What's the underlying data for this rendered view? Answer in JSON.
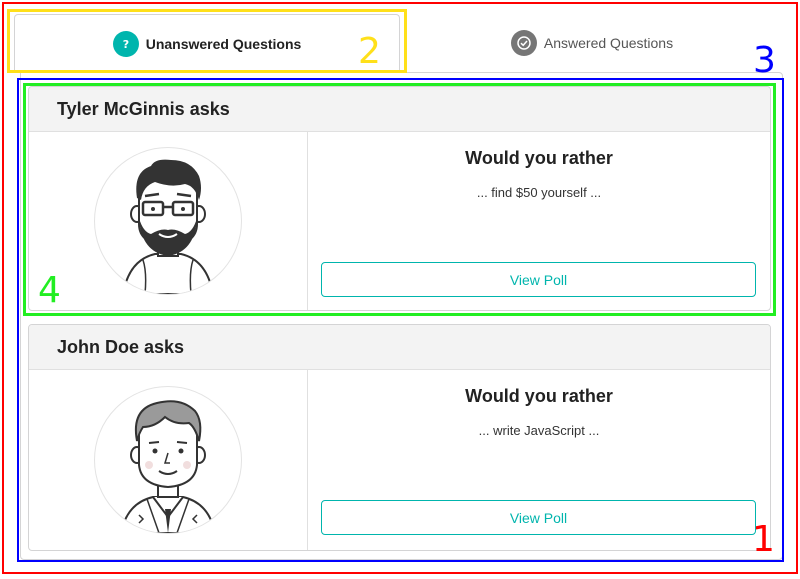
{
  "tabs": [
    {
      "label": "Unanswered Questions",
      "icon": "question-circle-icon",
      "active": true
    },
    {
      "label": "Answered Questions",
      "icon": "check-circle-icon",
      "active": false
    }
  ],
  "questions": [
    {
      "header": "Tyler McGinnis asks",
      "avatar_icon": "bearded-man-avatar",
      "title": "Would you rather",
      "preview": "... find $50 yourself ...",
      "button_label": "View Poll"
    },
    {
      "header": "John Doe asks",
      "avatar_icon": "man-in-suit-avatar",
      "title": "Would you rather",
      "preview": "... write JavaScript ...",
      "button_label": "View Poll"
    }
  ],
  "annotations": {
    "n1": "1",
    "n2": "2",
    "n3": "3",
    "n4": "4"
  },
  "colors": {
    "accent": "#00b5ad",
    "inactive_icon": "#767676"
  }
}
